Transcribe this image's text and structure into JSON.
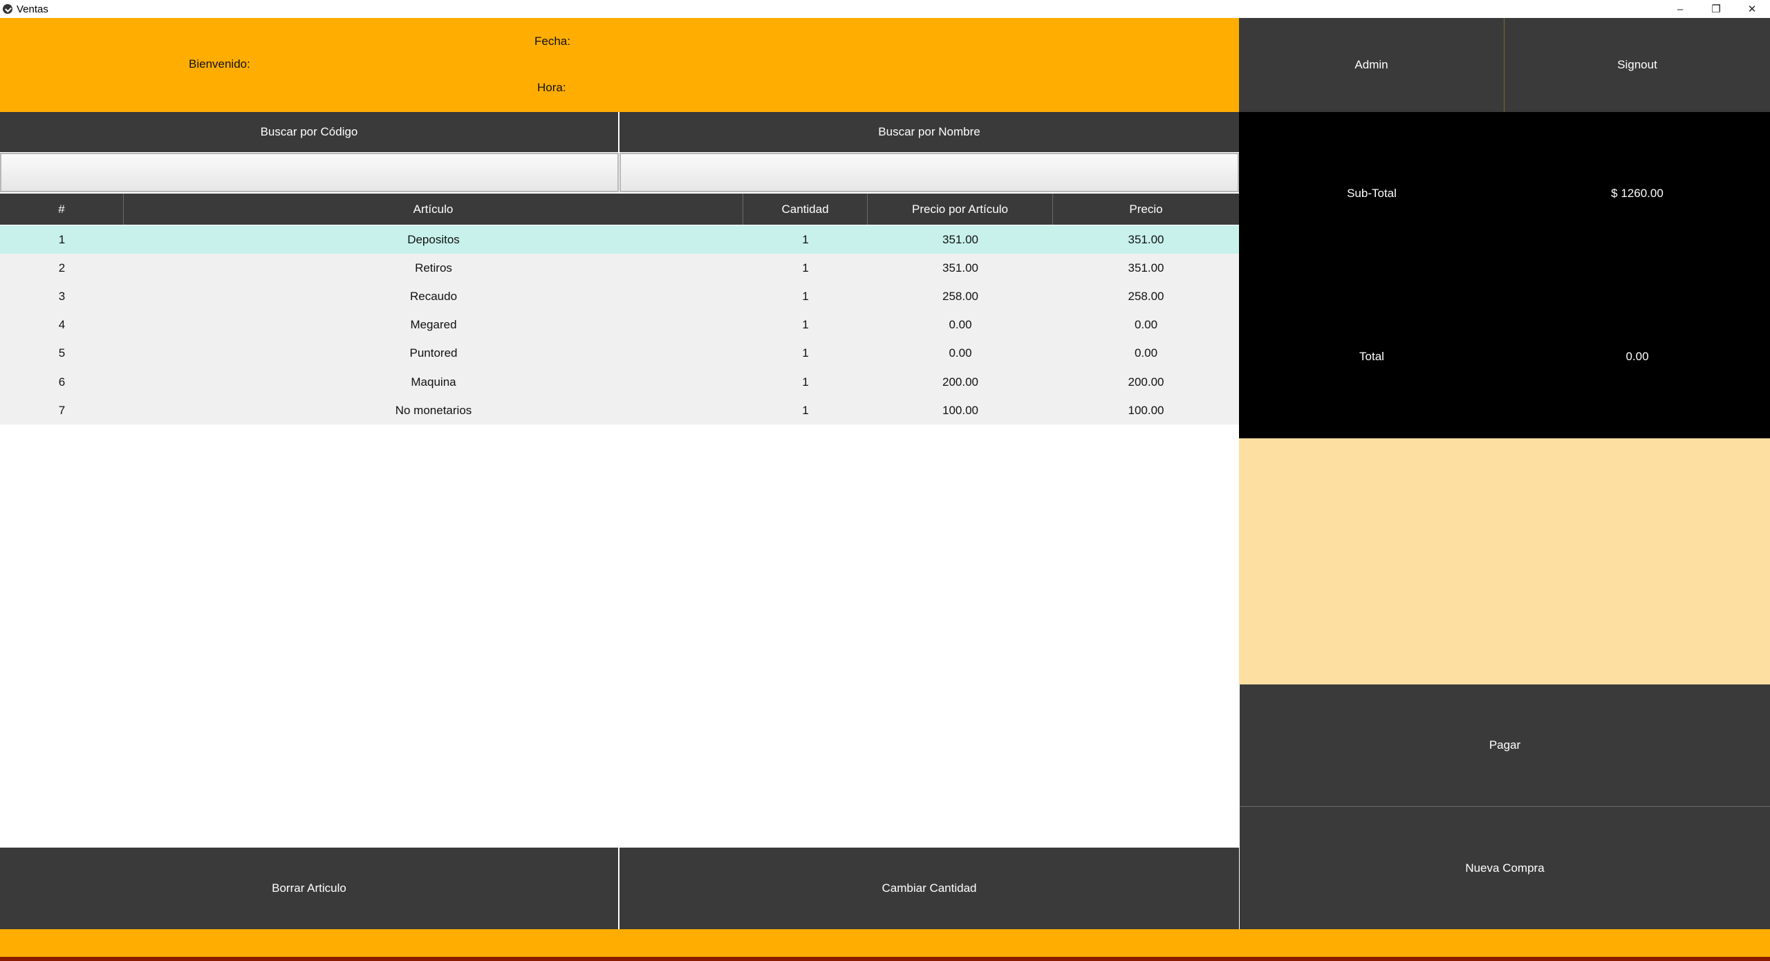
{
  "window": {
    "title": "Ventas",
    "controls": [
      "–",
      "❐",
      "✕"
    ]
  },
  "header": {
    "fecha_label": "Fecha:",
    "bienvenido_label": "Bienvenido:",
    "hora_label": "Hora:"
  },
  "top_buttons": {
    "admin": "Admin",
    "signout": "Signout"
  },
  "search": {
    "by_code_label": "Buscar por Código",
    "by_name_label": "Buscar por Nombre",
    "code_value": "",
    "name_value": ""
  },
  "table": {
    "columns": [
      "#",
      "Artículo",
      "Cantidad",
      "Precio por Artículo",
      "Precio"
    ],
    "rows": [
      [
        "1",
        "Depositos",
        "1",
        "351.00",
        "351.00"
      ],
      [
        "2",
        "Retiros",
        "1",
        "351.00",
        "351.00"
      ],
      [
        "3",
        "Recaudo",
        "1",
        "258.00",
        "258.00"
      ],
      [
        "4",
        "Megared",
        "1",
        "0.00",
        "0.00"
      ],
      [
        "5",
        "Puntored",
        "1",
        "0.00",
        "0.00"
      ],
      [
        "6",
        "Maquina",
        "1",
        "200.00",
        "200.00"
      ],
      [
        "7",
        "No monetarios",
        "1",
        "100.00",
        "100.00"
      ]
    ]
  },
  "bottom_buttons": {
    "delete": "Borrar Articulo",
    "change_qty": "Cambiar Cantidad"
  },
  "totals": {
    "subtotal_label": "Sub-Total",
    "subtotal_value": "$ 1260.00",
    "total_label": "Total",
    "total_value": "0.00"
  },
  "side_buttons": {
    "pay": "Pagar",
    "new_purchase": "Nueva Compra"
  },
  "colors": {
    "accent": "#ffad00",
    "dark": "#3a3a3a",
    "selected_row": "#c8f1eb",
    "peach": "#fddfa2"
  }
}
